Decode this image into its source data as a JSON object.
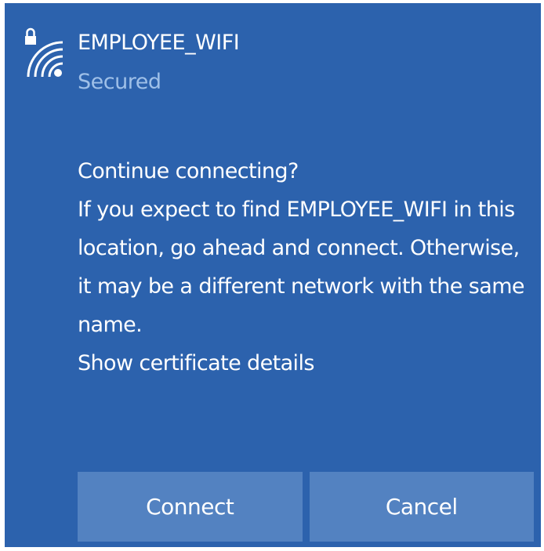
{
  "network": {
    "ssid": "EMPLOYEE_WIFI",
    "status": "Secured",
    "icon": "wifi-secured-icon"
  },
  "prompt": {
    "question": "Continue connecting?",
    "message": "If you expect to find EMPLOYEE_WIFI in this location, go ahead and connect. Otherwise, it may be a different network with the same name.",
    "link_label": "Show certificate details"
  },
  "actions": {
    "connect_label": "Connect",
    "cancel_label": "Cancel"
  },
  "colors": {
    "panel_background": "#2c62ad",
    "button_background": "#5382c1",
    "secondary_text": "#9fc0e8",
    "primary_text": "#ffffff"
  }
}
